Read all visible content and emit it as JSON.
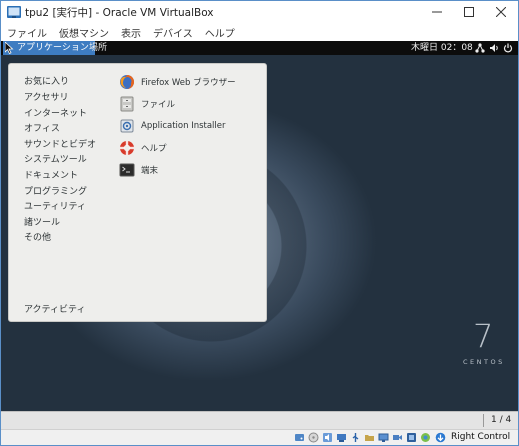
{
  "window": {
    "title": "tpu2 [実行中] - Oracle VM VirtualBox",
    "menu": [
      "ファイル",
      "仮想マシン",
      "表示",
      "デバイス",
      "ヘルプ"
    ]
  },
  "guest": {
    "topbar": {
      "applications_label": "アプリケーション",
      "places_label": "場所",
      "clock": "木曜日 02：08"
    },
    "app_menu": {
      "categories": [
        "お気に入り",
        "アクセサリ",
        "インターネット",
        "オフィス",
        "サウンドとビデオ",
        "システムツール",
        "ドキュメント",
        "プログラミング",
        "ユーティリティ",
        "諸ツール",
        "その他"
      ],
      "activities_label": "アクティビティ",
      "apps": [
        {
          "label": "Firefox Web ブラウザー",
          "icon": "firefox-icon"
        },
        {
          "label": "ファイル",
          "icon": "files-icon"
        },
        {
          "label": "Application Installer",
          "icon": "installer-icon"
        },
        {
          "label": "ヘルプ",
          "icon": "help-icon"
        },
        {
          "label": "端末",
          "icon": "terminal-icon"
        }
      ]
    },
    "branding": {
      "number": "7",
      "text": "CENTOS"
    },
    "workspace": "1 / 4"
  },
  "statusbar": {
    "host_key": "Right Control"
  }
}
